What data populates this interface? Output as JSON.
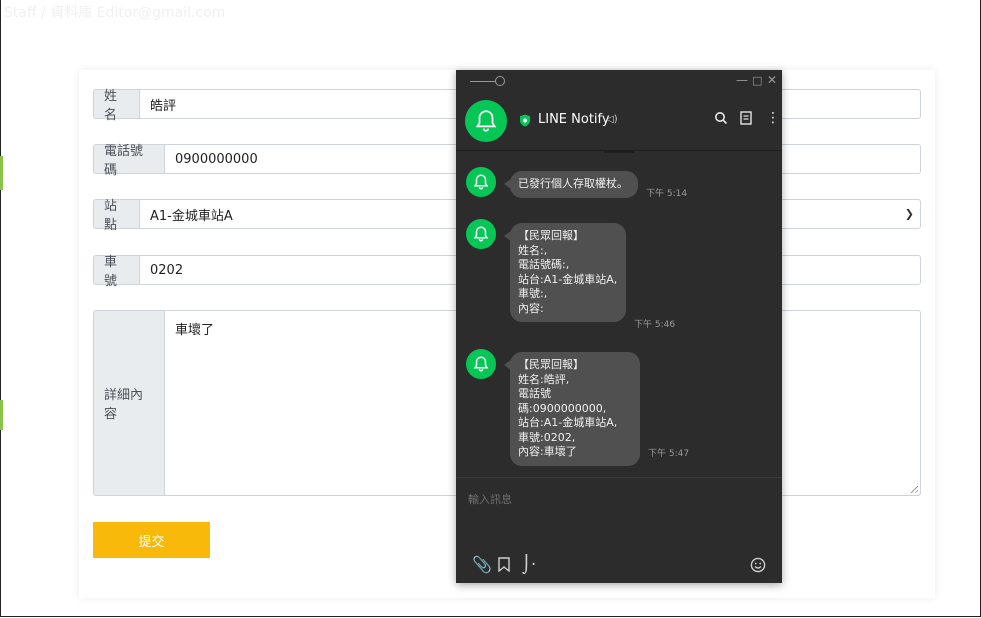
{
  "page": {
    "ghost_header": "Staff / 資料庫 Editor@gmail.com"
  },
  "form": {
    "name": {
      "label": "姓名",
      "value": "皓評"
    },
    "phone": {
      "label": "電話號碼",
      "value": "0900000000"
    },
    "station": {
      "label": "站點",
      "value": "A1-金城車站A"
    },
    "car": {
      "label": "車號",
      "value": "0202"
    },
    "details": {
      "label": "詳細內容",
      "value": "車壞了"
    },
    "submit_label": "提交"
  },
  "line_window": {
    "chat_title": "LINE Notify",
    "messages": [
      {
        "text": "已發行個人存取權杖。",
        "time": "下午 5:14"
      },
      {
        "text": "【民眾回報】\n姓名:,\n電話號碼:,\n站台:A1-金城車站A,\n車號:,\n內容:",
        "time": "下午 5:46"
      },
      {
        "text": "【民眾回報】\n姓名:皓評,\n電話號碼:0900000000,\n站台:A1-金城車站A,\n車號:0202,\n內容:車壞了",
        "time": "下午 5:47"
      }
    ],
    "input_placeholder": "輸入訊息",
    "colors": {
      "accent": "#06c755",
      "bg": "#2c2c2c",
      "bubble": "#505050"
    }
  },
  "colors": {
    "submit": "#f9b90a",
    "addon_bg": "#e9ecef"
  }
}
